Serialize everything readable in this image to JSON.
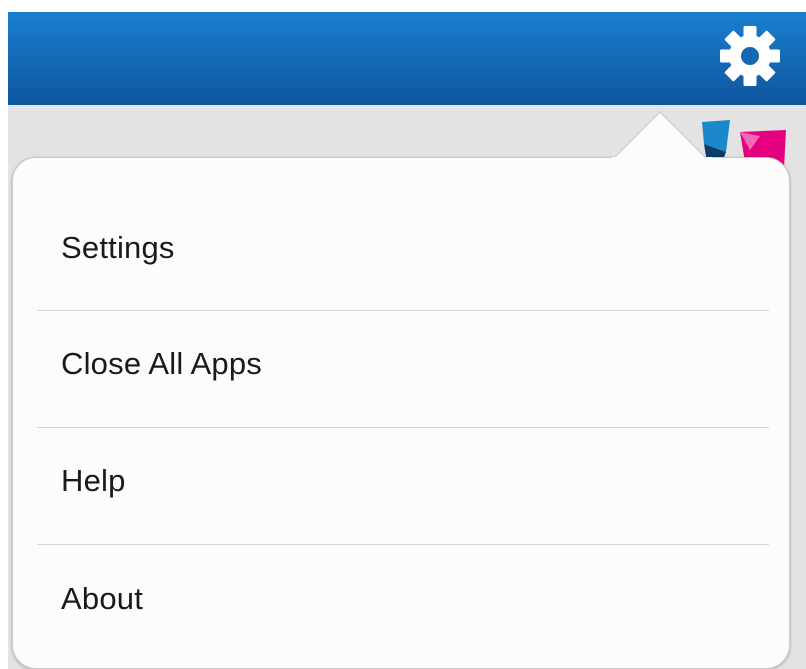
{
  "header": {
    "background_color": "#1468b4",
    "settings_icon": "gear-icon"
  },
  "app_logo": {
    "icon": "app-logo-icon",
    "colors": [
      "#1a88c9",
      "#0d3c6b",
      "#e4007f"
    ]
  },
  "menu": {
    "items": [
      {
        "label": "Settings"
      },
      {
        "label": "Close All Apps"
      },
      {
        "label": "Help"
      },
      {
        "label": "About"
      }
    ]
  }
}
